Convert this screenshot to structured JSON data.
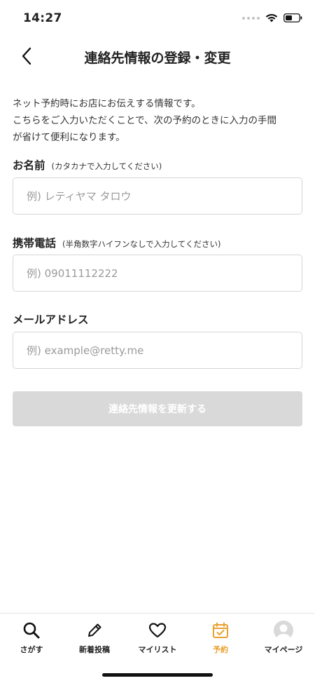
{
  "status_bar": {
    "time": "14:27"
  },
  "header": {
    "title": "連絡先情報の登録・変更"
  },
  "description": [
    "ネット予約時にお店にお伝えする情報です。",
    "こちらをご入力いただくことで、次の予約のときに入力の手間",
    "が省けて便利になります。"
  ],
  "form": {
    "name": {
      "label": "お名前",
      "hint": "(カタカナで入力してください)",
      "placeholder": "例) レティヤマ タロウ",
      "value": ""
    },
    "phone": {
      "label": "携帯電話",
      "hint": "(半角数字ハイフンなしで入力してください)",
      "placeholder": "例) 09011112222",
      "value": ""
    },
    "email": {
      "label": "メールアドレス",
      "placeholder": "例) example@retty.me",
      "value": ""
    },
    "submit_label": "連絡先情報を更新する"
  },
  "tab_bar": {
    "active_color": "#e9a12f",
    "items": [
      {
        "label": "さがす",
        "icon": "search-icon"
      },
      {
        "label": "新着投稿",
        "icon": "pencil-icon"
      },
      {
        "label": "マイリスト",
        "icon": "heart-icon"
      },
      {
        "label": "予約",
        "icon": "calendar-check-icon",
        "active": true
      },
      {
        "label": "マイページ",
        "icon": "avatar-icon"
      }
    ]
  }
}
